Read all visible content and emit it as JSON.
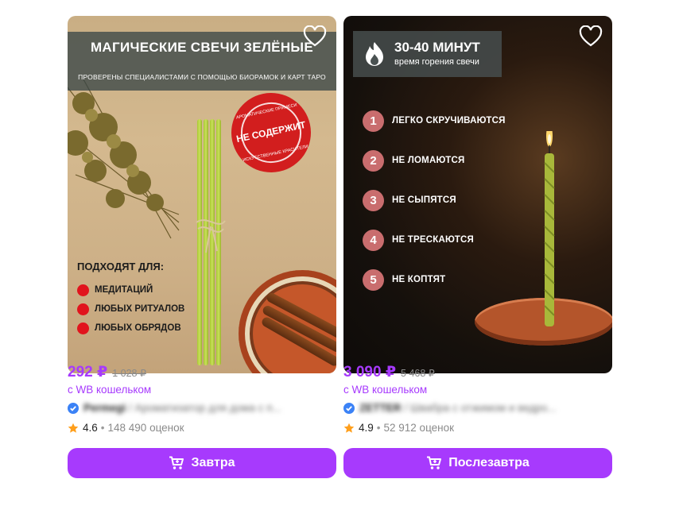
{
  "products": [
    {
      "banner_title": "МАГИЧЕСКИЕ СВЕЧИ ЗЕЛЁНЫЕ",
      "banner_subtitle": "ПРОВЕРЕНЫ СПЕЦИАЛИСТАМИ С ПОМОЩЬЮ БИОРАМОК И КАРТ ТАРО",
      "stamp_main": "НЕ СОДЕРЖИТ",
      "stamp_top": "АРОМАТИЧЕСКИЕ ПРИМЕСИ",
      "stamp_bottom": "ИСКУССТВЕННЫЕ КРАСИТЕЛИ",
      "suits_heading": "ПОДХОДЯТ ДЛЯ:",
      "suits": [
        "МЕДИТАЦИЙ",
        "ЛЮБЫХ РИТУАЛОВ",
        "ЛЮБЫХ ОБРЯДОВ"
      ],
      "price": "292 ₽",
      "old_price": "1 028 ₽",
      "wallet_note": "с WB кошельком",
      "brand": "Permegi",
      "title": " / Ароматизатор для дома с п...",
      "rating": "4.6",
      "reviews": "148 490 оценок",
      "button_label": "Завтра",
      "accent_color": "#a73afd"
    },
    {
      "banner_title": "30-40 МИНУТ",
      "banner_subtitle": "время горения свечи",
      "features": [
        {
          "num": "1",
          "text": "ЛЕГКО СКРУЧИВАЮТСЯ"
        },
        {
          "num": "2",
          "text": "НЕ ЛОМАЮТСЯ"
        },
        {
          "num": "3",
          "text": "НЕ СЫПЯТСЯ"
        },
        {
          "num": "4",
          "text": "НЕ ТРЕСКАЮТСЯ"
        },
        {
          "num": "5",
          "text": "НЕ КОПТЯТ"
        }
      ],
      "price": "3 090 ₽",
      "old_price": "5 468 ₽",
      "wallet_note": "с WB кошельком",
      "brand": "ZETTER",
      "title": " / Швабра с отжимом и ведро...",
      "rating": "4.9",
      "reviews": "52 912 оценок",
      "button_label": "Послезавтра",
      "accent_color": "#a73afd"
    }
  ],
  "icons": [
    "heart-icon",
    "verified-check-icon",
    "star-icon",
    "cart-icon",
    "fire-icon"
  ]
}
